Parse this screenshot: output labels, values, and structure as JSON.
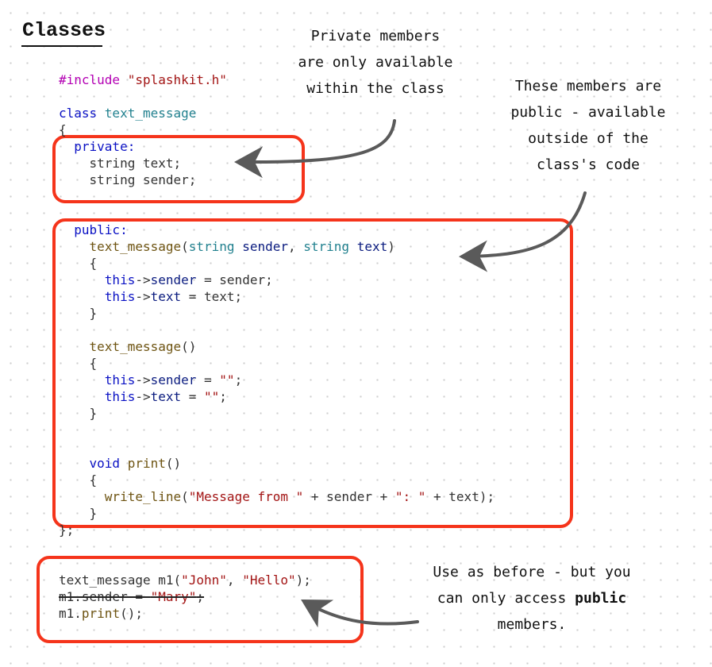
{
  "title": "Classes",
  "code_top": [
    [
      {
        "t": "#include ",
        "c": "pp"
      },
      {
        "t": "\"splashkit.h\"",
        "c": "str"
      }
    ],
    [],
    [
      {
        "t": "class ",
        "c": "kw"
      },
      {
        "t": "text_message",
        "c": "typ"
      }
    ],
    [
      {
        "t": "{",
        "c": ""
      }
    ],
    [
      {
        "t": "  private:",
        "c": "kw"
      }
    ],
    [
      {
        "t": "    string text;",
        "c": ""
      }
    ],
    [
      {
        "t": "    string sender;",
        "c": ""
      }
    ],
    [],
    [],
    [
      {
        "t": "  public:",
        "c": "kw"
      }
    ],
    [
      {
        "t": "    text_message",
        "c": "fn"
      },
      {
        "t": "(",
        "c": ""
      },
      {
        "t": "string ",
        "c": "typ"
      },
      {
        "t": "sender",
        "c": "var"
      },
      {
        "t": ", ",
        "c": ""
      },
      {
        "t": "string ",
        "c": "typ"
      },
      {
        "t": "text",
        "c": "var"
      },
      {
        "t": ")",
        "c": ""
      }
    ],
    [
      {
        "t": "    {",
        "c": ""
      }
    ],
    [
      {
        "t": "      this",
        "c": "kw"
      },
      {
        "t": "->",
        "c": ""
      },
      {
        "t": "sender",
        "c": "var"
      },
      {
        "t": " = sender;",
        "c": ""
      }
    ],
    [
      {
        "t": "      this",
        "c": "kw"
      },
      {
        "t": "->",
        "c": ""
      },
      {
        "t": "text",
        "c": "var"
      },
      {
        "t": " = text;",
        "c": ""
      }
    ],
    [
      {
        "t": "    }",
        "c": ""
      }
    ],
    [],
    [
      {
        "t": "    text_message",
        "c": "fn"
      },
      {
        "t": "()",
        "c": ""
      }
    ],
    [
      {
        "t": "    {",
        "c": ""
      }
    ],
    [
      {
        "t": "      this",
        "c": "kw"
      },
      {
        "t": "->",
        "c": ""
      },
      {
        "t": "sender",
        "c": "var"
      },
      {
        "t": " = ",
        "c": ""
      },
      {
        "t": "\"\"",
        "c": "str"
      },
      {
        "t": ";",
        "c": ""
      }
    ],
    [
      {
        "t": "      this",
        "c": "kw"
      },
      {
        "t": "->",
        "c": ""
      },
      {
        "t": "text",
        "c": "var"
      },
      {
        "t": " = ",
        "c": ""
      },
      {
        "t": "\"\"",
        "c": "str"
      },
      {
        "t": ";",
        "c": ""
      }
    ],
    [
      {
        "t": "    }",
        "c": ""
      }
    ],
    [],
    [],
    [
      {
        "t": "    void ",
        "c": "kw"
      },
      {
        "t": "print",
        "c": "fn"
      },
      {
        "t": "()",
        "c": ""
      }
    ],
    [
      {
        "t": "    {",
        "c": ""
      }
    ],
    [
      {
        "t": "      write_line",
        "c": "fn"
      },
      {
        "t": "(",
        "c": ""
      },
      {
        "t": "\"Message from \"",
        "c": "str"
      },
      {
        "t": " + sender + ",
        "c": ""
      },
      {
        "t": "\": \"",
        "c": "str"
      },
      {
        "t": " + text);",
        "c": ""
      }
    ],
    [
      {
        "t": "    }",
        "c": ""
      }
    ],
    [
      {
        "t": "};",
        "c": ""
      }
    ]
  ],
  "code_bottom": [
    [
      {
        "t": "text_message m1(",
        "c": ""
      },
      {
        "t": "\"John\"",
        "c": "str"
      },
      {
        "t": ", ",
        "c": ""
      },
      {
        "t": "\"Hello\"",
        "c": "str"
      },
      {
        "t": ");",
        "c": ""
      }
    ],
    [
      {
        "t": "m1.sender = ",
        "c": "",
        "s": true
      },
      {
        "t": "\"Mary\"",
        "c": "str",
        "s": true
      },
      {
        "t": ";",
        "c": "",
        "s": true
      }
    ],
    [
      {
        "t": "m1.",
        "c": ""
      },
      {
        "t": "print",
        "c": "fn"
      },
      {
        "t": "();",
        "c": ""
      }
    ]
  ],
  "notes": {
    "private": "Private members\nare only available\nwithin the class",
    "public": "These members are\npublic - available\noutside of the\nclass's code",
    "usage_before": "Use as before - but you\ncan only access ",
    "usage_bold": "public",
    "usage_after": "\nmembers."
  },
  "colors": {
    "box_border": "#f5341b",
    "arrow": "#5a5a5a",
    "keyword": "#0a11c4",
    "type": "#22818f",
    "function": "#6e5412",
    "string": "#a31515",
    "preprocessor": "#b400b4"
  }
}
